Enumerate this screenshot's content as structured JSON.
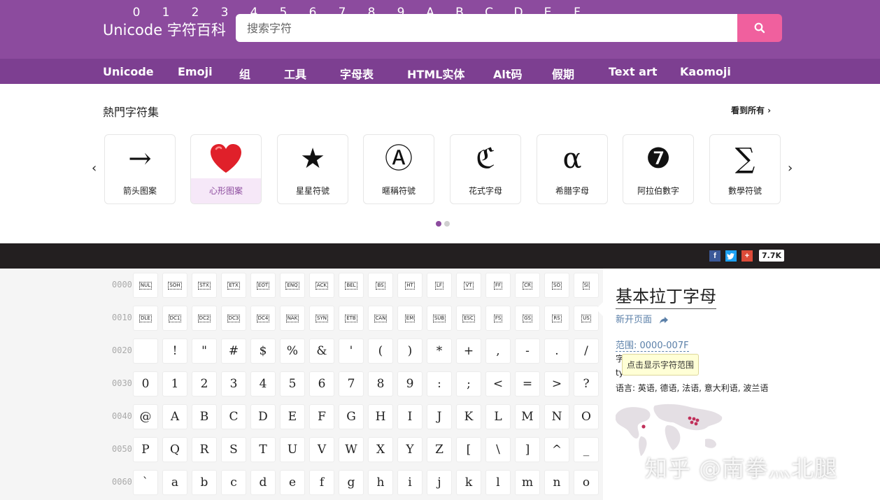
{
  "header": {
    "brand": "Unicode 字符百科",
    "search_placeholder": "搜索字符",
    "nav": [
      "Unicode",
      "Emoji",
      "组",
      "工具",
      "字母表",
      "HTML实体",
      "Alt码",
      "假期",
      "Text art",
      "Kaomoji"
    ]
  },
  "popular": {
    "title": "熱門字符集",
    "see_all": "看到所有 ›",
    "prev": "‹",
    "next": "›",
    "cards": [
      {
        "glyph": "→",
        "label": "箭头图案"
      },
      {
        "glyph": "",
        "label": "心形图案",
        "icon": "heart-emoji"
      },
      {
        "glyph": "★",
        "label": "星星符號"
      },
      {
        "glyph": "Ⓐ",
        "label": "暱稱符號"
      },
      {
        "glyph": "ℭ",
        "label": "花式字母"
      },
      {
        "glyph": "α",
        "label": "希腊字母"
      },
      {
        "glyph": "❼",
        "label": "阿拉伯數字"
      },
      {
        "glyph": "∑",
        "label": "數學符號"
      }
    ]
  },
  "hex_header": [
    "0",
    "1",
    "2",
    "3",
    "4",
    "5",
    "6",
    "7",
    "8",
    "9",
    "A",
    "B",
    "C",
    "D",
    "E",
    "F"
  ],
  "social": {
    "count": "7.7K",
    "icons": [
      "facebook-icon",
      "twitter-icon",
      "google-plus-icon"
    ]
  },
  "grid": {
    "rows": [
      {
        "label": "0000",
        "control": true,
        "cells": [
          "NUL",
          "SOH",
          "STX",
          "ETX",
          "EOT",
          "ENQ",
          "ACK",
          "BEL",
          "BS",
          "HT",
          "LF",
          "VT",
          "FF",
          "CR",
          "SO",
          "SI"
        ]
      },
      {
        "label": "0010",
        "control": true,
        "cells": [
          "DLE",
          "DC1",
          "DC2",
          "DC3",
          "DC4",
          "NAK",
          "SYN",
          "ETB",
          "CAN",
          "EM",
          "SUB",
          "ESC",
          "FS",
          "GS",
          "RS",
          "US"
        ]
      },
      {
        "label": "0020",
        "control": false,
        "cells": [
          " ",
          "!",
          "\"",
          "#",
          "$",
          "%",
          "&",
          "'",
          "(",
          ")",
          "*",
          "+",
          ",",
          "-",
          ".",
          "/"
        ]
      },
      {
        "label": "0030",
        "control": false,
        "cells": [
          "0",
          "1",
          "2",
          "3",
          "4",
          "5",
          "6",
          "7",
          "8",
          "9",
          ":",
          ";",
          "<",
          "=",
          ">",
          "?"
        ]
      },
      {
        "label": "0040",
        "control": false,
        "cells": [
          "@",
          "A",
          "B",
          "C",
          "D",
          "E",
          "F",
          "G",
          "H",
          "I",
          "J",
          "K",
          "L",
          "M",
          "N",
          "O"
        ]
      },
      {
        "label": "0050",
        "control": false,
        "cells": [
          "P",
          "Q",
          "R",
          "S",
          "T",
          "U",
          "V",
          "W",
          "X",
          "Y",
          "Z",
          "[",
          "\\",
          "]",
          "^",
          "_"
        ]
      },
      {
        "label": "0060",
        "control": false,
        "cells": [
          "`",
          "a",
          "b",
          "c",
          "d",
          "e",
          "f",
          "g",
          "h",
          "i",
          "j",
          "k",
          "l",
          "m",
          "n",
          "o"
        ]
      }
    ]
  },
  "info": {
    "title": "基本拉丁字母",
    "new_page": "新开页面",
    "range": "范围: 0000-007F",
    "line1": "字",
    "line2": "ty",
    "languages": "语言: 英语, 德语, 法语, 意大利语, 波兰语",
    "tooltip": "点击显示字符范围"
  },
  "watermark": "知乎 @南拳灬北腿",
  "colors": {
    "header": "#8c4b9e",
    "nav": "#7d3f91",
    "accent": "#f0609e",
    "dark": "#231f20"
  }
}
